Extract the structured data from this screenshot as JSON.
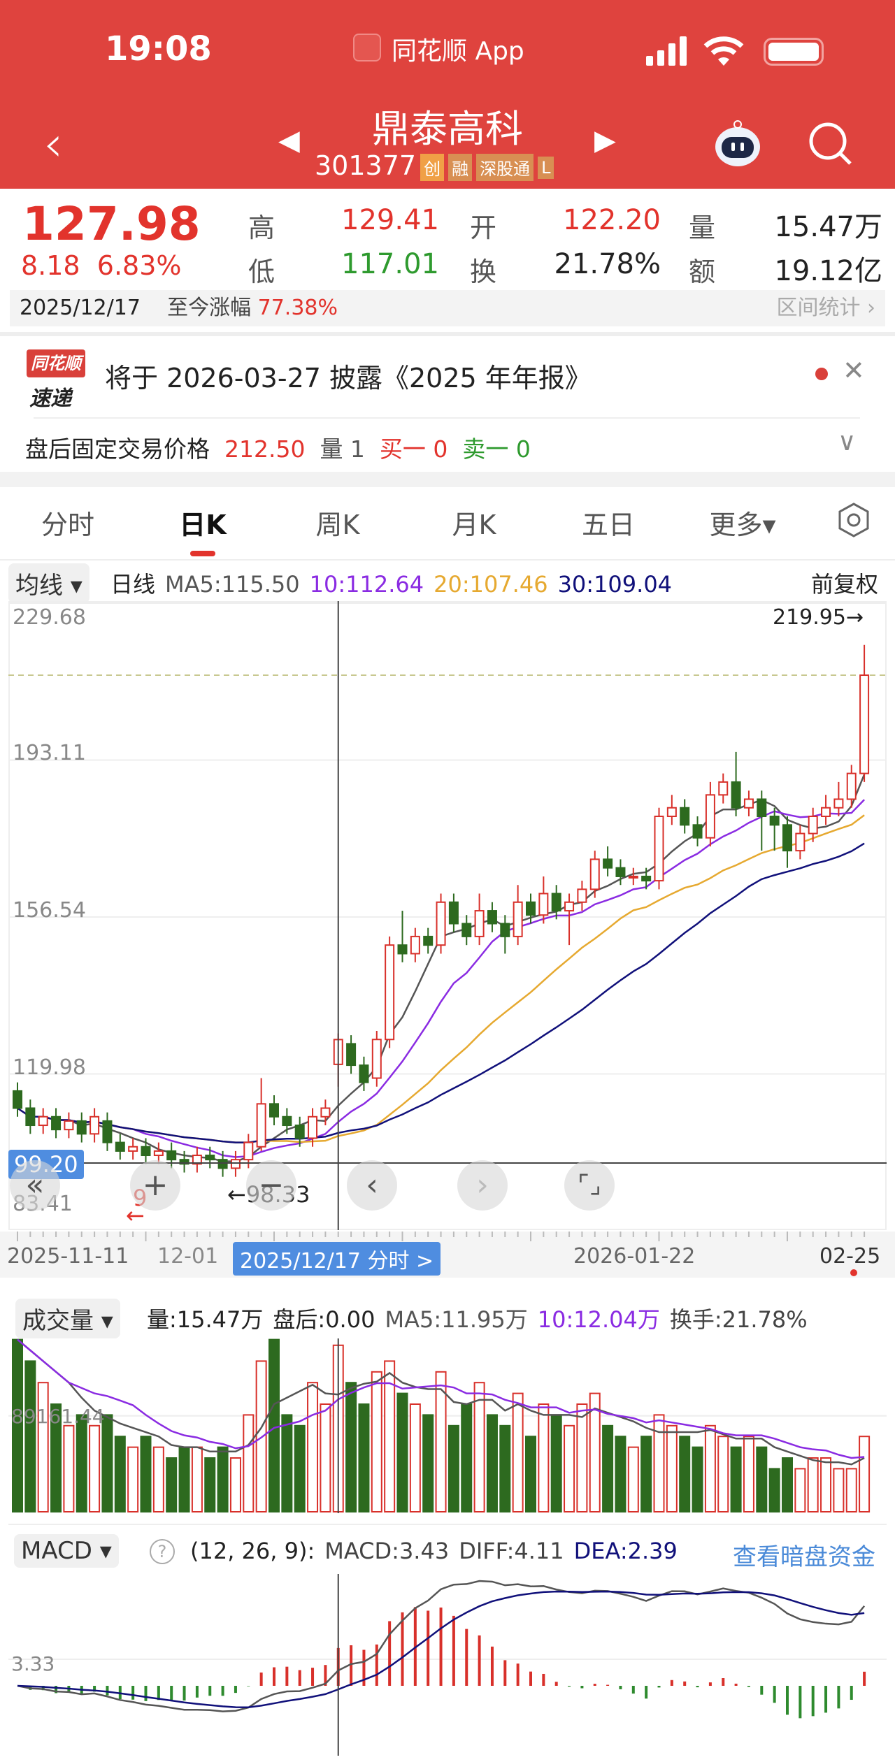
{
  "status": {
    "time": "19:08",
    "app": "同花顺 App"
  },
  "nav": {
    "title": "鼎泰高科",
    "code": "301377",
    "badges": [
      "创",
      "融",
      "深股通",
      "L"
    ]
  },
  "quote": {
    "price": "127.98",
    "change": "8.18",
    "change_pct": "6.83%",
    "high_label": "高",
    "high": "129.41",
    "low_label": "低",
    "low": "117.01",
    "open_label": "开",
    "open": "122.20",
    "turnover_label": "换",
    "turnover": "21.78%",
    "vol_label": "量",
    "vol": "15.47万",
    "amt_label": "额",
    "amt": "19.12亿"
  },
  "period": {
    "date": "2025/12/17",
    "gain_label": "至今涨幅",
    "gain": "77.38%",
    "stats_link": "区间统计 ›"
  },
  "notice": {
    "logo_top": "同花顺",
    "logo_bottom": "速递",
    "text": "将于 2026-03-27 披露《2025 年年报》"
  },
  "after_hours": {
    "label": "盘后固定交易价格",
    "price": "212.50",
    "vol": "量 1",
    "buy": "买一 0",
    "sell": "卖一 0"
  },
  "tabs": [
    "分时",
    "日K",
    "周K",
    "月K",
    "五日",
    "更多▾"
  ],
  "ma_legend": {
    "selector": "均线 ▾",
    "type": "日线",
    "ma5": "MA5:115.50",
    "ma10": "10:112.64",
    "ma20": "20:107.46",
    "ma30": "30:109.04",
    "adjust": "前复权"
  },
  "kline_labels": {
    "y_ticks": [
      "229.68",
      "193.11",
      "156.54",
      "119.98",
      "83.41"
    ],
    "high_mark": "219.95→",
    "cross_price": "99.20",
    "low_mark": "←98.33",
    "nine": "9",
    "nine_arrow": "←"
  },
  "x_axis": {
    "d1": "2025-11-11",
    "d2": "12-01",
    "cross": "2025/12/17 分时 >",
    "d3": "2026-01-22",
    "d4": "02-25"
  },
  "vol_legend": {
    "selector": "成交量 ▾",
    "vol": "量:15.47万",
    "after": "盘后:0.00",
    "ma5": "MA5:11.95万",
    "ma10": "10:12.04万",
    "turnover": "换手:21.78%",
    "y_tick": "89161.44"
  },
  "macd_legend": {
    "selector": "MACD ▾",
    "help": "?",
    "params": "(12, 26, 9):",
    "macd": "MACD:3.43",
    "diff": "DIFF:4.11",
    "dea": "DEA:2.39",
    "link": "查看暗盘资金",
    "y_tick": "3.33"
  },
  "colors": {
    "up": "#d8302a",
    "down": "#2d6a1f",
    "ma5": "#555555",
    "ma10": "#8a2be2",
    "ma20": "#e6a930",
    "ma30": "#10107a"
  },
  "chart_data": {
    "type": "candlestick",
    "ylim": [
      83.41,
      229.68
    ],
    "open": [
      116,
      112,
      108,
      110,
      107,
      109,
      106,
      109,
      104,
      102,
      103,
      101,
      102,
      100,
      99,
      101,
      100,
      98,
      100,
      103,
      113,
      110,
      108,
      105,
      110,
      122.2,
      127,
      122,
      119,
      128,
      150,
      148,
      152,
      150,
      160,
      155,
      152,
      158,
      155,
      152,
      160,
      157,
      162,
      158,
      160,
      163,
      170,
      168,
      166,
      166,
      165,
      180,
      182,
      178,
      175,
      185,
      188,
      182,
      184,
      180,
      178,
      172,
      176,
      180,
      182,
      184,
      190
    ],
    "close": [
      112,
      108,
      110,
      107,
      109,
      106,
      110,
      104,
      102,
      103,
      101,
      102,
      100,
      99,
      101,
      100,
      98,
      100,
      104,
      113,
      110,
      108,
      105,
      110,
      112,
      127.98,
      122,
      118,
      128,
      150,
      148,
      152,
      150,
      160,
      155,
      152,
      158,
      155,
      152,
      160,
      157,
      162,
      158,
      160,
      163,
      170,
      168,
      166,
      166,
      165,
      180,
      182,
      178,
      175,
      185,
      188,
      182,
      184,
      180,
      178,
      172,
      176,
      180,
      182,
      184,
      190,
      212.9
    ],
    "high": [
      118,
      114,
      112,
      112,
      111,
      111,
      112,
      111,
      106,
      105,
      105,
      104,
      104,
      102,
      103,
      103,
      102,
      102,
      106,
      119,
      115,
      112,
      110,
      112,
      114,
      129.41,
      129,
      124,
      130,
      152,
      158,
      154,
      154,
      162,
      162,
      157,
      162,
      160,
      157,
      164,
      162,
      166,
      164,
      162,
      165,
      172,
      173,
      170,
      168,
      168,
      182,
      185,
      184,
      180,
      188,
      190,
      195,
      186,
      186,
      182,
      180,
      178,
      182,
      185,
      188,
      192,
      219.95
    ],
    "low": [
      110,
      106,
      106,
      105,
      105,
      104,
      104,
      102,
      100,
      100,
      99,
      99,
      98,
      97,
      97,
      98,
      96,
      96,
      98,
      102,
      108,
      106,
      103,
      103,
      108,
      117.01,
      120,
      116,
      117,
      126,
      146,
      146,
      148,
      148,
      153,
      150,
      150,
      153,
      148,
      150,
      155,
      155,
      156,
      150,
      158,
      161,
      166,
      164,
      164,
      163,
      163,
      178,
      176,
      173,
      173,
      183,
      180,
      180,
      172,
      172,
      168,
      170,
      174,
      178,
      180,
      182,
      188
    ],
    "volume_wan": [
      16,
      14,
      12,
      10,
      8,
      9,
      8,
      9,
      7,
      6,
      7,
      6,
      5,
      6,
      6,
      5,
      6,
      5,
      9,
      14,
      16,
      9,
      8,
      12,
      10,
      15.47,
      12,
      10,
      13,
      14,
      11,
      10,
      9,
      13,
      8,
      10,
      12,
      9,
      8,
      11,
      7,
      10,
      9,
      8,
      10,
      11,
      8,
      7,
      6,
      7,
      9,
      8,
      7,
      6,
      8,
      7,
      6,
      7,
      6,
      4,
      5,
      4,
      5,
      5,
      4,
      4,
      7
    ],
    "ma_periods": [
      5,
      10,
      20,
      30
    ],
    "macd_params": [
      12,
      26,
      9
    ],
    "crosshair_index": 25
  }
}
